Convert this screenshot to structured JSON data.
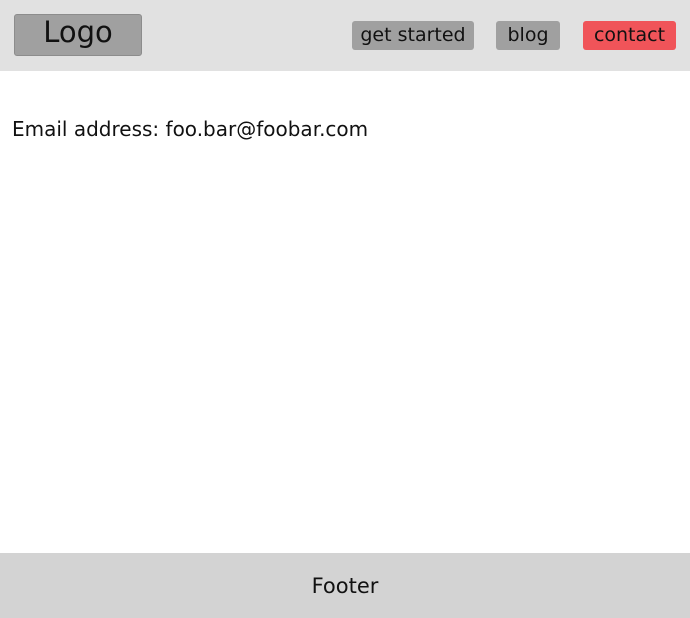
{
  "header": {
    "logo_text": "Logo",
    "nav": {
      "get_started": "get started",
      "blog": "blog",
      "contact": "contact"
    }
  },
  "main": {
    "email_label": "Email address:",
    "email_value": "foo.bar@foobar.com"
  },
  "footer": {
    "text": "Footer"
  },
  "colors": {
    "header_bg": "#e1e1e1",
    "button_gray": "#a0a0a0",
    "contact_accent": "#f05459",
    "footer_bg": "#d3d3d3"
  }
}
